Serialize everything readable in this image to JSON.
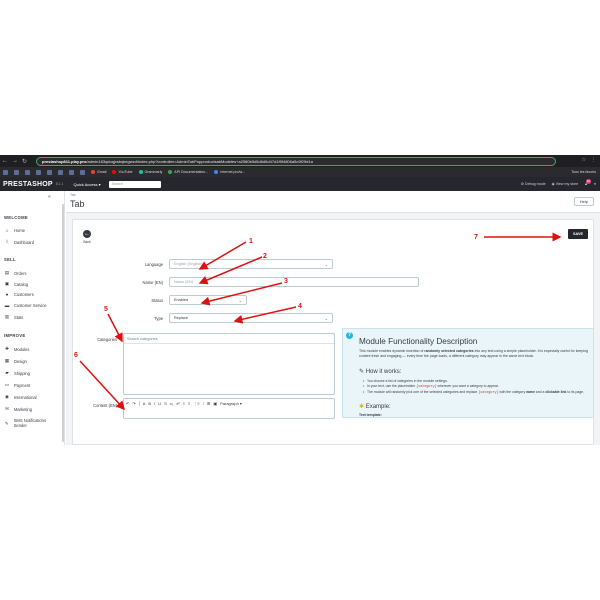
{
  "browser": {
    "nav_icons": [
      "←",
      "→",
      "↻"
    ],
    "url_host": "prestashop811.play.pro",
    "url_rest": "/admin183qdoqjcsbqkegwzd/index.php?controller=AdminTabPopproductsabModeles+a2580b5d5d6d5d47d1f9f4806a5c9f29d1a",
    "right_icons": [
      "☆",
      "⋮"
    ],
    "bookmarks": [
      "Gmail",
      "YouTube",
      "Grammarly",
      "API Documentation...",
      "Internet.pro/w..."
    ],
    "bookmark_right": "Tous les favoris"
  },
  "header": {
    "logo": "PRESTASHOP",
    "version": "8.1.1",
    "quick_access": "Quick Access ▾",
    "search_placeholder": "Search",
    "debug": "Debug mode",
    "view_store": "View my store",
    "notif_count": "12"
  },
  "sidebar": {
    "collapse": "«",
    "sections": [
      "WELCOME",
      "SELL",
      "IMPROVE"
    ],
    "welcome": [
      {
        "label": "Home",
        "icon": "⌂"
      },
      {
        "label": "Dashboard",
        "icon": "⌇"
      }
    ],
    "sell": [
      {
        "label": "Orders",
        "icon": "▤"
      },
      {
        "label": "Catalog",
        "icon": "▣"
      },
      {
        "label": "Customers",
        "icon": "●"
      },
      {
        "label": "Customer Service",
        "icon": "▬"
      },
      {
        "label": "Stats",
        "icon": "▥"
      }
    ],
    "improve": [
      {
        "label": "Modules",
        "icon": "✚"
      },
      {
        "label": "Design",
        "icon": "▦"
      },
      {
        "label": "Shipping",
        "icon": "▰"
      },
      {
        "label": "Payment",
        "icon": "▭"
      },
      {
        "label": "International",
        "icon": "◉"
      },
      {
        "label": "Marketing",
        "icon": "✉"
      },
      {
        "label": "SMS Notifications Sender",
        "icon": "✎"
      }
    ]
  },
  "page": {
    "breadcrumb": "Tab",
    "title": "Tab",
    "help_label": "Help",
    "back_label": "Back",
    "save_label": "SAVE"
  },
  "form": {
    "language_label": "Language",
    "language_value": "English (English)",
    "name_label": "Name (EN)",
    "name_value": "Name (EN)",
    "status_label": "Status",
    "status_value": "Enabled",
    "type_label": "Type",
    "type_value": "Replace",
    "categories_label": "Categories",
    "categories_search": "Search categories",
    "content_label": "Content (EN)",
    "paragraph_label": "Paragraph ▾",
    "toolbar_icons": [
      "↶",
      "↷",
      "A",
      "B",
      "I",
      "U",
      "S",
      "x₂",
      "x²",
      "≡",
      "≡",
      "⋮≡",
      "⁝",
      "⊞",
      "▣"
    ]
  },
  "info": {
    "icon": "?",
    "title": "Module Functionality Description",
    "p1_a": "This module enables dynamic insertion of ",
    "p1_b": "randomly selected categories",
    "p1_c": " into any text using a simple placeholder. It is especially useful for keeping content fresh and engaging — every time the page loads, a different category may appear in the same text block.",
    "how_title": "How it works:",
    "li1": "You choose a list of categories in the module settings.",
    "li2_a": "In your text, use the placeholder ",
    "li2_code": "{category}",
    "li2_b": " wherever you want a category to appear.",
    "li3_a": "The module will randomly pick one of the selected categories and replace ",
    "li3_code": "{category}",
    "li3_b": " with the category ",
    "li3_c": "name",
    "li3_d": " and a ",
    "li3_e": "clickable link",
    "li3_f": " to its page.",
    "example_title": "Example:",
    "template_label": "Text template:"
  },
  "annotations": [
    "1",
    "2",
    "3",
    "4",
    "5",
    "6",
    "7"
  ],
  "colors": {
    "arrow": "#e01010",
    "accent": "#25b9d7",
    "header": "#25272c"
  }
}
